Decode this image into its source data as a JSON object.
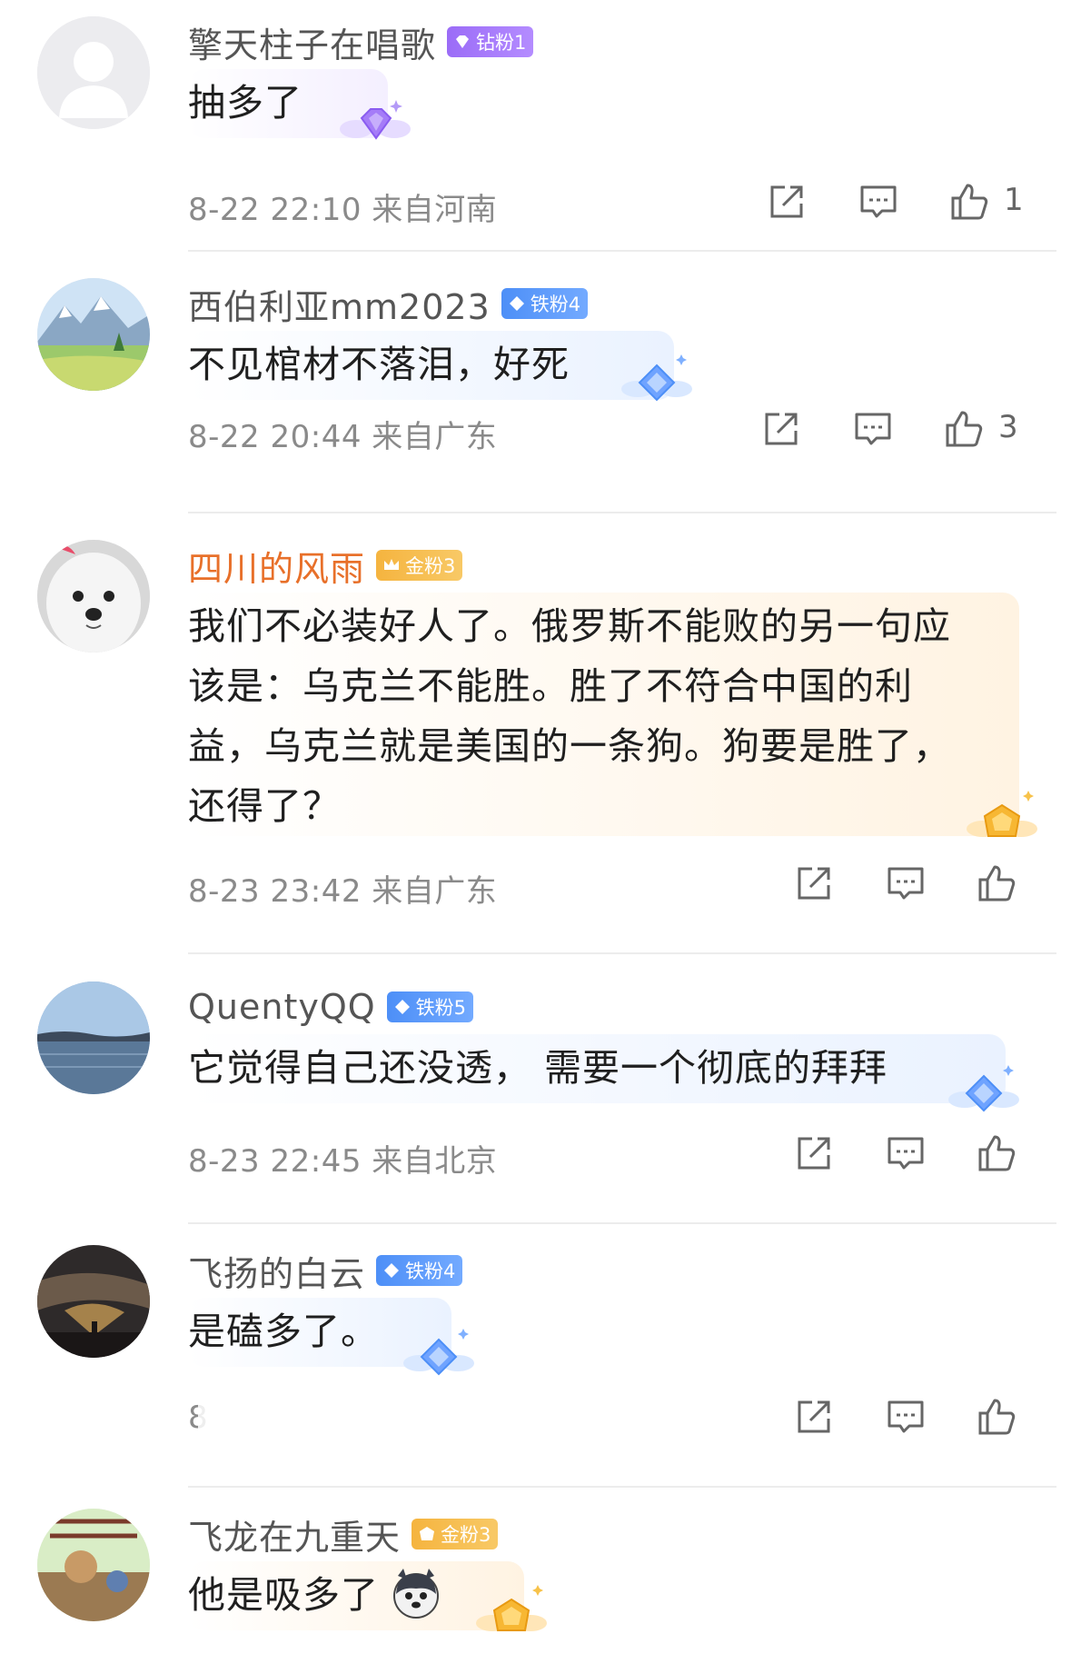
{
  "colors": {
    "username": "#555555",
    "username_highlight": "#e8702a",
    "meta": "#8a8a8a",
    "badge_diamond": "#9b6cf7",
    "badge_iron": "#4d8ff7",
    "badge_gold": "#f5b43f"
  },
  "comments": [
    {
      "username": "擎天柱子在唱歌",
      "badge": "钻粉1",
      "text": [
        "抽多了"
      ],
      "time": "8-22 22:10 来自河南",
      "likes": "1",
      "icons": [
        "share-icon",
        "reply-icon",
        "like-icon"
      ]
    },
    {
      "username": "西伯利亚mm2023",
      "badge": "铁粉4",
      "text": [
        "不见棺材不落泪，好死"
      ],
      "time": "8-22 20:44 来自广东",
      "likes": "3",
      "icons": [
        "share-icon",
        "reply-icon",
        "like-icon"
      ]
    },
    {
      "username": "四川的风雨",
      "badge": "金粉3",
      "text": [
        "我们不必装好人了。俄罗斯不能败的另一句应",
        "该是：乌克兰不能胜。胜了不符合中国的利",
        "益，乌克兰就是美国的一条狗。狗要是胜了，",
        "还得了？"
      ],
      "time": "8-23 23:42 来自广东",
      "likes": "",
      "icons": [
        "share-icon",
        "reply-icon",
        "like-icon"
      ]
    },
    {
      "username": "QuentyQQ",
      "badge": "铁粉5",
      "text": [
        "它觉得自己还没透， 需要一个彻底的拜拜"
      ],
      "time": "8-23 22:45 来自北京",
      "likes": "",
      "icons": [
        "share-icon",
        "reply-icon",
        "like-icon"
      ]
    },
    {
      "username": "飞扬的白云",
      "badge": "铁粉4",
      "text": [
        "是磕多了。"
      ],
      "time": "8",
      "likes": "",
      "icons": [
        "share-icon",
        "reply-icon",
        "like-icon"
      ]
    },
    {
      "username": "飞龙在九重天",
      "badge": "金粉3",
      "text": [
        "他是吸多了"
      ],
      "time": "",
      "likes": "",
      "icons": [
        "husky-emoji-icon"
      ]
    }
  ]
}
